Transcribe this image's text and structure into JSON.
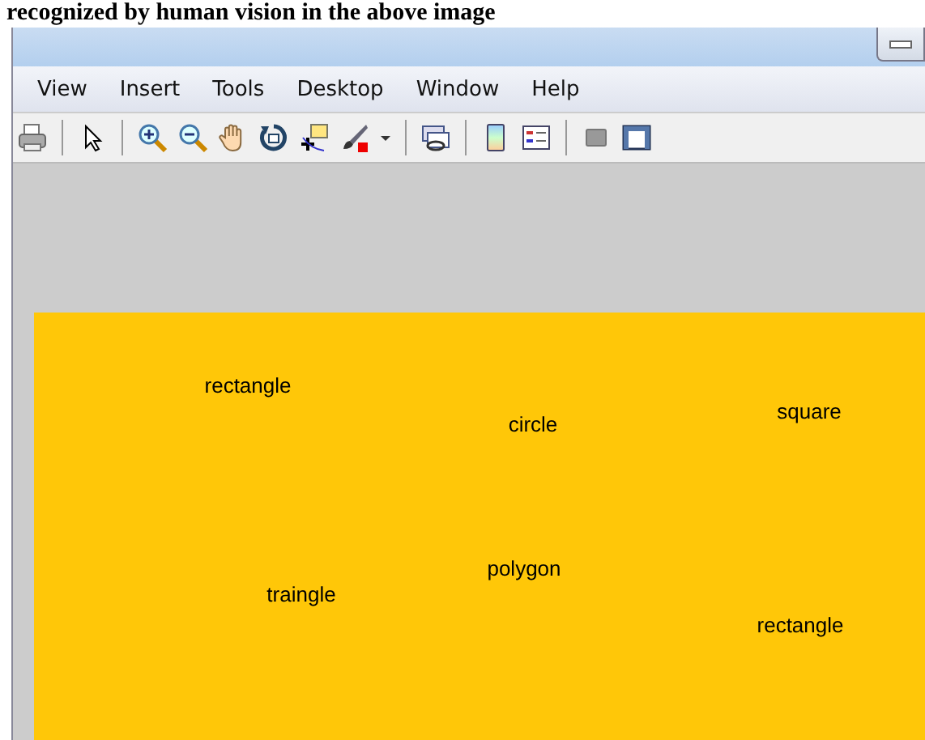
{
  "caption": "recognized by human vision in the above image",
  "menu": [
    "View",
    "Insert",
    "Tools",
    "Desktop",
    "Window",
    "Help"
  ],
  "toolbar": [
    {
      "kind": "printer"
    },
    {
      "kind": "sep"
    },
    {
      "kind": "pointer"
    },
    {
      "kind": "sep"
    },
    {
      "kind": "zoomin"
    },
    {
      "kind": "zoomout"
    },
    {
      "kind": "hand"
    },
    {
      "kind": "rotate"
    },
    {
      "kind": "cursor"
    },
    {
      "kind": "brush"
    },
    {
      "kind": "caret"
    },
    {
      "kind": "sep"
    },
    {
      "kind": "link"
    },
    {
      "kind": "sep"
    },
    {
      "kind": "colorbar"
    },
    {
      "kind": "legend"
    },
    {
      "kind": "sep"
    },
    {
      "kind": "square"
    },
    {
      "kind": "frame"
    }
  ],
  "labels": [
    "rectangle",
    "circle",
    "square",
    "polygon",
    "traingle",
    "rectangle"
  ]
}
